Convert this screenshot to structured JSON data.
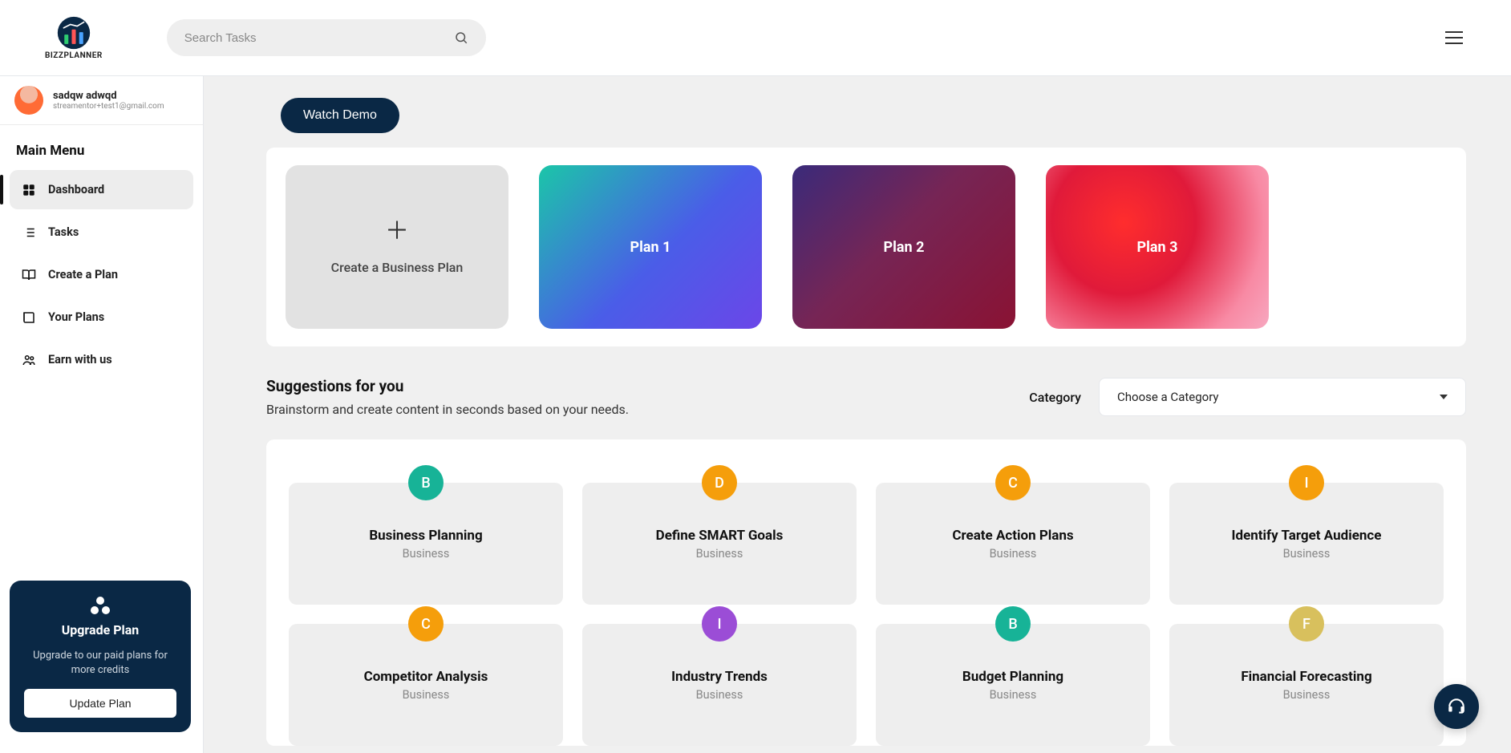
{
  "app_name": "BIZZPLANNER",
  "search": {
    "placeholder": "Search Tasks"
  },
  "user": {
    "name": "sadqw adwqd",
    "email": "streamentor+test1@gmail.com"
  },
  "main_menu_title": "Main Menu",
  "sidebar": {
    "items": [
      {
        "label": "Dashboard",
        "icon": "grid-icon",
        "active": true
      },
      {
        "label": "Tasks",
        "icon": "list-icon"
      },
      {
        "label": "Create a Plan",
        "icon": "book-open-icon"
      },
      {
        "label": "Your Plans",
        "icon": "book-icon"
      },
      {
        "label": "Earn with us",
        "icon": "users-icon"
      }
    ]
  },
  "upgrade": {
    "title": "Upgrade Plan",
    "text": "Upgrade to our paid plans for more credits",
    "button": "Update Plan"
  },
  "watch_demo": "Watch Demo",
  "plans": {
    "create_label": "Create a Business Plan",
    "items": [
      {
        "label": "Plan 1"
      },
      {
        "label": "Plan 2"
      },
      {
        "label": "Plan 3"
      }
    ]
  },
  "suggestions": {
    "title": "Suggestions for you",
    "subtitle": "Brainstorm and create content in seconds based on your needs.",
    "category_label": "Category",
    "category_placeholder": "Choose a Category",
    "cards": [
      {
        "letter": "B",
        "color": "#17b397",
        "title": "Business Planning",
        "category": "Business"
      },
      {
        "letter": "D",
        "color": "#f59e0b",
        "title": "Define SMART Goals",
        "category": "Business"
      },
      {
        "letter": "C",
        "color": "#f59e0b",
        "title": "Create Action Plans",
        "category": "Business"
      },
      {
        "letter": "I",
        "color": "#f59e0b",
        "title": "Identify Target Audience",
        "category": "Business"
      },
      {
        "letter": "C",
        "color": "#f59e0b",
        "title": "Competitor Analysis",
        "category": "Business"
      },
      {
        "letter": "I",
        "color": "#9b4dd6",
        "title": "Industry Trends",
        "category": "Business"
      },
      {
        "letter": "B",
        "color": "#17b397",
        "title": "Budget Planning",
        "category": "Business"
      },
      {
        "letter": "F",
        "color": "#d8c05d",
        "title": "Financial Forecasting",
        "category": "Business"
      }
    ]
  }
}
